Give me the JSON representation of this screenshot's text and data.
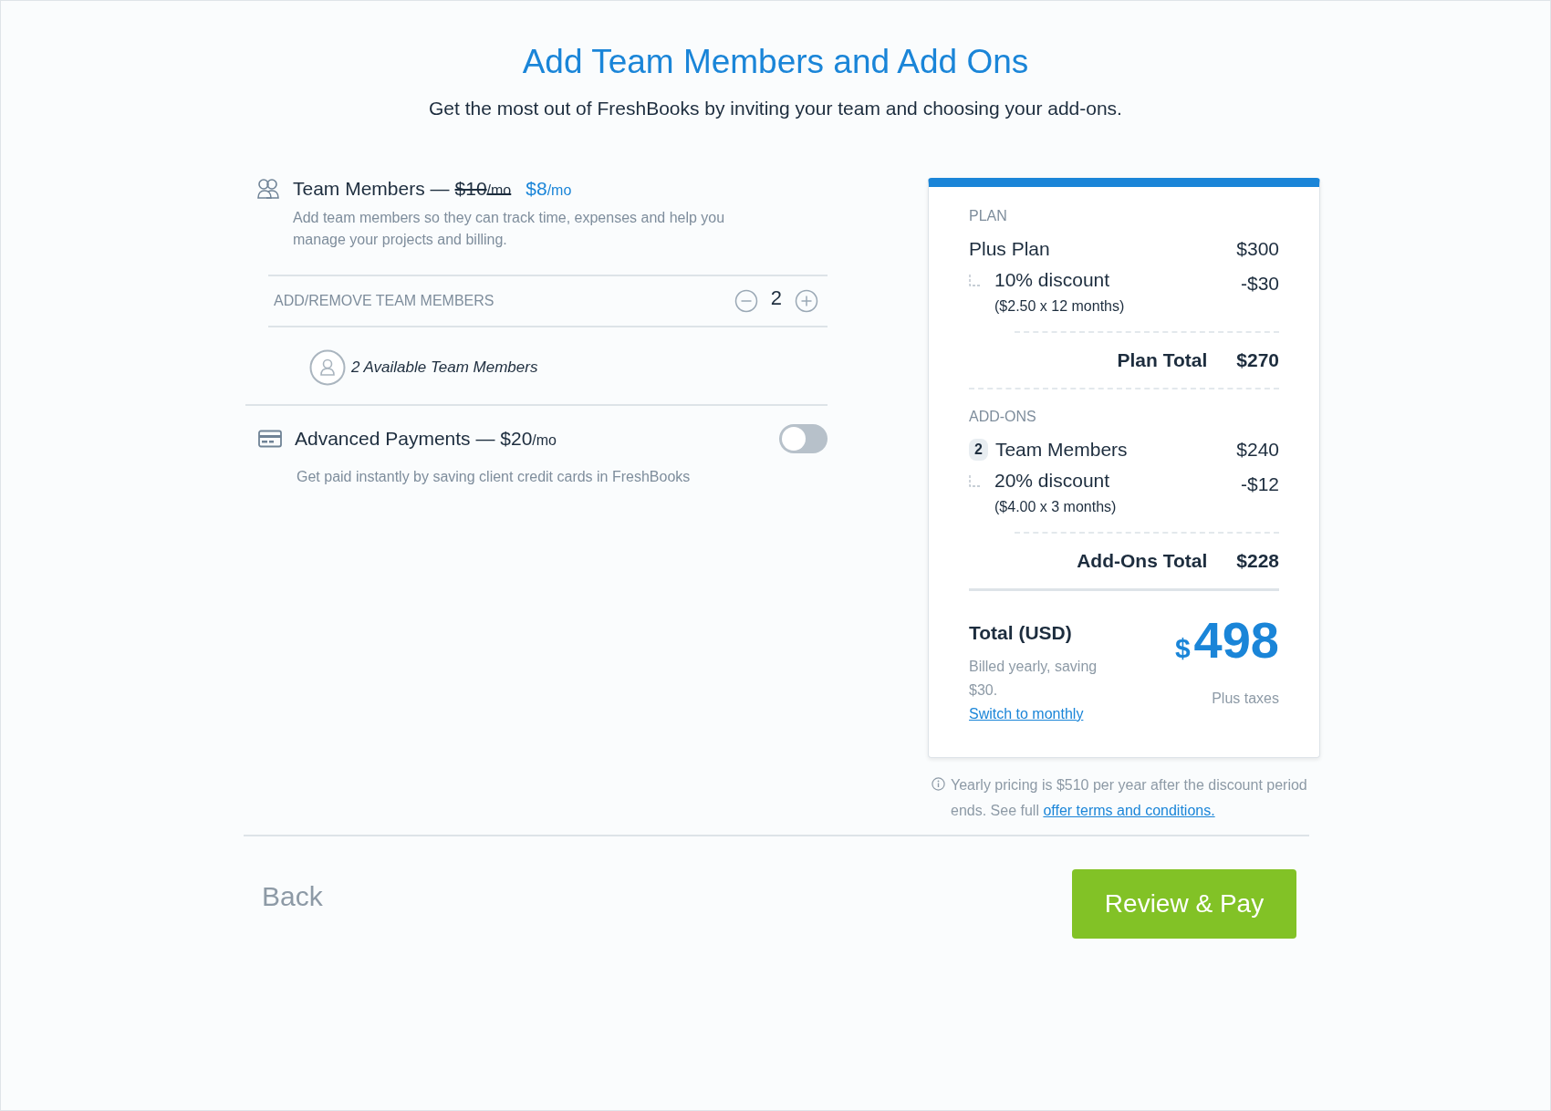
{
  "header": {
    "title": "Add Team Members and Add Ons",
    "subtitle": "Get the most out of FreshBooks by inviting your team and choosing your add-ons."
  },
  "addons": [
    {
      "kind": "team",
      "title": "Team Members —",
      "old_price": "$10",
      "old_unit": "/mo",
      "price": "$8",
      "unit": "/mo",
      "description": "Add team members so they can track time, expenses and help you manage your projects and billing.",
      "stepper_label": "ADD/REMOVE TEAM MEMBERS",
      "count": "2",
      "available": "2 Available Team Members"
    },
    {
      "kind": "toggle",
      "title": "Advanced Payments — $20",
      "unit": "/mo",
      "description": "Get paid instantly by saving client credit cards in FreshBooks",
      "on": false
    }
  ],
  "summary": {
    "sections": [
      {
        "label": "PLAN",
        "items": [
          {
            "kind": "line",
            "name": "Plus Plan",
            "amount": "$300"
          },
          {
            "kind": "discount",
            "name": "10% discount",
            "detail": "($2.50 x 12 months)",
            "amount": "-$30"
          }
        ],
        "total_label": "Plan Total",
        "total_amount": "$270"
      },
      {
        "label": "ADD-ONS",
        "items": [
          {
            "kind": "line",
            "badge": "2",
            "name": "Team Members",
            "amount": "$240"
          },
          {
            "kind": "discount",
            "name": "20% discount",
            "detail": "($4.00 x 3 months)",
            "amount": "-$12"
          }
        ],
        "total_label": "Add-Ons Total",
        "total_amount": "$228"
      }
    ],
    "total": {
      "label": "Total (USD)",
      "currency": "$",
      "amount": "498",
      "note": "Billed yearly, saving $30.",
      "link": "Switch to monthly",
      "taxes": "Plus taxes"
    },
    "footnote": {
      "text": "Yearly pricing is $510 per year after the discount period ends. See full",
      "link": "offer terms and conditions."
    }
  },
  "footer": {
    "back": "Back",
    "primary": "Review & Pay"
  }
}
